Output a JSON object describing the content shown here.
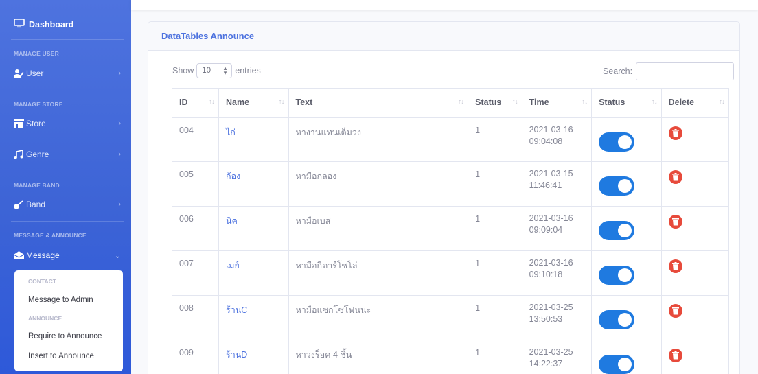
{
  "sidebar": {
    "brand": "Dashboard",
    "headings": [
      "MANAGE USER",
      "MANAGE STORE",
      "MANAGE BAND",
      "MESSAGE & ANNOUNCE"
    ],
    "items": [
      {
        "label": "User",
        "icon": "user-icon"
      },
      {
        "label": "Store",
        "icon": "store-icon"
      },
      {
        "label": "Genre",
        "icon": "music-icon"
      },
      {
        "label": "Band",
        "icon": "guitar-icon"
      },
      {
        "label": "Message",
        "icon": "envelope-open-icon"
      }
    ],
    "submenu": {
      "contact_heading": "CONTACT",
      "contact_item": "Message to Admin",
      "announce_heading": "ANNOUNCE",
      "announce_items": [
        "Require to Announce",
        "Insert to Announce"
      ]
    }
  },
  "card": {
    "title": "DataTables Announce",
    "show_label": "Show",
    "entries_value": "10",
    "entries_label": "entries",
    "search_label": "Search:"
  },
  "table": {
    "columns": [
      "ID",
      "Name",
      "Text",
      "Status",
      "Time",
      "Status",
      "Delete"
    ],
    "rows": [
      {
        "id": "004",
        "name": "ไก่",
        "text": "หางานแทนเต็มวง",
        "status": "1",
        "date": "2021-03-16",
        "time": "09:04:08",
        "enabled": true
      },
      {
        "id": "005",
        "name": "ก้อง",
        "text": "หามือกลอง",
        "status": "1",
        "date": "2021-03-15",
        "time": "11:46:41",
        "enabled": true
      },
      {
        "id": "006",
        "name": "นิค",
        "text": "หามือเบส",
        "status": "1",
        "date": "2021-03-16",
        "time": "09:09:04",
        "enabled": true
      },
      {
        "id": "007",
        "name": "เมย์",
        "text": "หามือกีตาร์โซโล่",
        "status": "1",
        "date": "2021-03-16",
        "time": "09:10:18",
        "enabled": true
      },
      {
        "id": "008",
        "name": "ร้านC",
        "text": "หามือแซกโซโฟนน่ะ",
        "status": "1",
        "date": "2021-03-25",
        "time": "13:50:53",
        "enabled": true
      },
      {
        "id": "009",
        "name": "ร้านD",
        "text": "หาวงร็อค 4 ชิ้น",
        "status": "1",
        "date": "2021-03-25",
        "time": "14:22:37",
        "enabled": true
      }
    ]
  },
  "colors": {
    "sidebar": "#4e73df",
    "title": "#4e73df",
    "toggle": "#1f7ae0",
    "delete": "#e74a3b"
  }
}
